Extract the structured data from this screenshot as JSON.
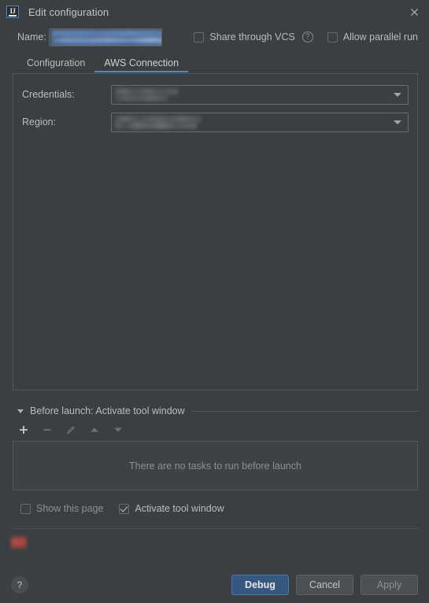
{
  "window": {
    "title": "Edit configuration",
    "app_icon": "intellij-idea-icon",
    "close_icon": "close-icon"
  },
  "name_row": {
    "label": "Name:",
    "value": "",
    "value_redacted": true,
    "share_through_vcs": {
      "label": "Share through VCS",
      "checked": false,
      "help_icon": "question-mark-icon"
    },
    "allow_parallel_run": {
      "label": "Allow parallel run",
      "checked": false
    }
  },
  "tabs": [
    {
      "label": "Configuration",
      "active": false
    },
    {
      "label": "AWS Connection",
      "active": true
    }
  ],
  "aws_connection": {
    "fields": [
      {
        "label": "Credentials:",
        "value": "",
        "value_redacted": true,
        "arrow_icon": "chevron-down-icon"
      },
      {
        "label": "Region:",
        "value": "",
        "value_redacted": true,
        "arrow_icon": "chevron-down-icon"
      }
    ]
  },
  "before_launch": {
    "expander_icon": "triangle-down-icon",
    "title": "Before launch: Activate tool window",
    "toolbar": [
      {
        "name": "add",
        "icon": "plus-icon",
        "enabled": true
      },
      {
        "name": "remove",
        "icon": "minus-icon",
        "enabled": false
      },
      {
        "name": "edit",
        "icon": "pencil-icon",
        "enabled": false
      },
      {
        "name": "move-up",
        "icon": "arrow-up-icon",
        "enabled": false
      },
      {
        "name": "move-down",
        "icon": "arrow-down-icon",
        "enabled": false
      }
    ],
    "empty_text": "There are no tasks to run before launch"
  },
  "bottom_options": {
    "show_this_page": {
      "label": "Show this page",
      "checked": false,
      "enabled": false
    },
    "activate_tool_window": {
      "label": "Activate tool window",
      "checked": true,
      "enabled": true
    }
  },
  "status": {
    "error_icon": "error-icon",
    "message": "",
    "message_redacted": true
  },
  "buttons": {
    "help": {
      "label": "?",
      "icon": "question-mark-icon"
    },
    "debug": {
      "label": "Debug",
      "primary": true,
      "enabled": true
    },
    "cancel": {
      "label": "Cancel",
      "primary": false,
      "enabled": true
    },
    "apply": {
      "label": "Apply",
      "primary": false,
      "enabled": false
    }
  },
  "colors": {
    "background": "#3c3f41",
    "accent": "#4a88c7",
    "primary_button": "#365880",
    "border": "#555759",
    "text": "#bbbbbb",
    "error": "#b24a45"
  }
}
